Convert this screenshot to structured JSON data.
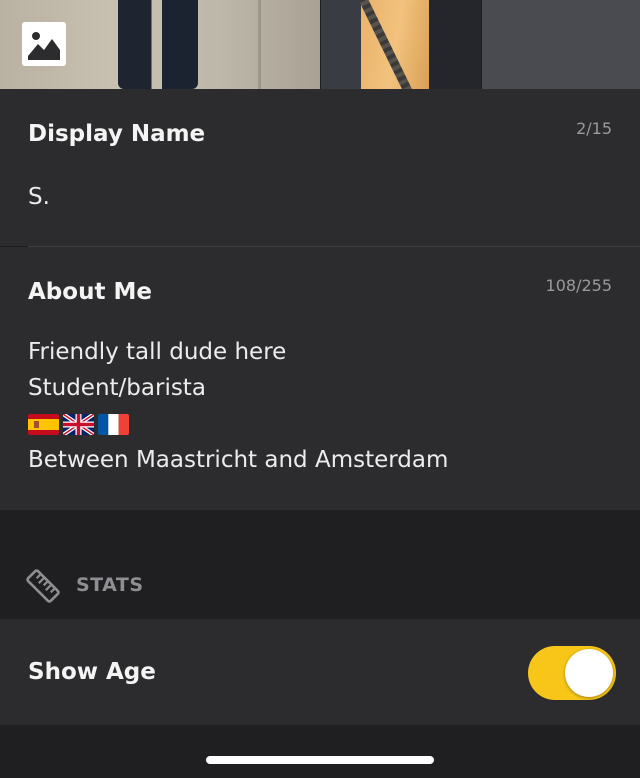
{
  "photos": {
    "add_icon": "image-icon"
  },
  "display_name": {
    "label": "Display Name",
    "counter": "2/15",
    "value": "S."
  },
  "about_me": {
    "label": "About Me",
    "counter": "108/255",
    "lines": [
      "Friendly tall dude here",
      "Student/barista",
      "Between Maastricht and Amsterdam"
    ],
    "flags": [
      "spain-flag",
      "uk-flag",
      "france-flag"
    ]
  },
  "stats": {
    "icon": "ruler-icon",
    "label": "STATS"
  },
  "show_age": {
    "label": "Show Age",
    "enabled": true,
    "toggle_color": "#f7c619"
  }
}
